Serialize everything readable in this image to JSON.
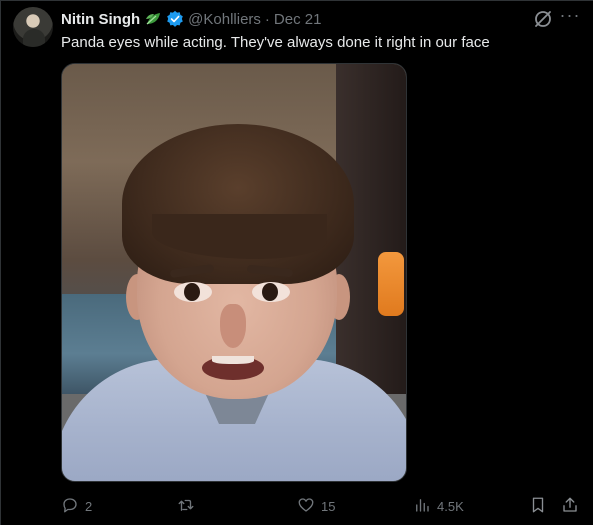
{
  "tweet": {
    "author_name": "Nitin Singh",
    "handle": "@Kohlliers",
    "separator": "·",
    "date": "Dec 21",
    "text": "Panda eyes while acting. They've always done it right in our face",
    "more_glyph": "···"
  },
  "icons": {
    "leaf": "leaf-emoji-icon",
    "verified": "verified-badge-icon",
    "grok": "grok-icon",
    "more": "more-icon",
    "reply": "reply-icon",
    "retweet": "retweet-icon",
    "like": "like-icon",
    "views": "views-icon",
    "bookmark": "bookmark-icon",
    "share": "share-icon"
  },
  "metrics": {
    "replies": "2",
    "retweets": "",
    "likes": "15",
    "views": "4.5K"
  },
  "colors": {
    "background": "#000000",
    "primary_text": "#e7e9ea",
    "secondary_text": "#71767b",
    "verified_blue": "#1d9bf0",
    "leaf_green": "#3c9a3c"
  }
}
